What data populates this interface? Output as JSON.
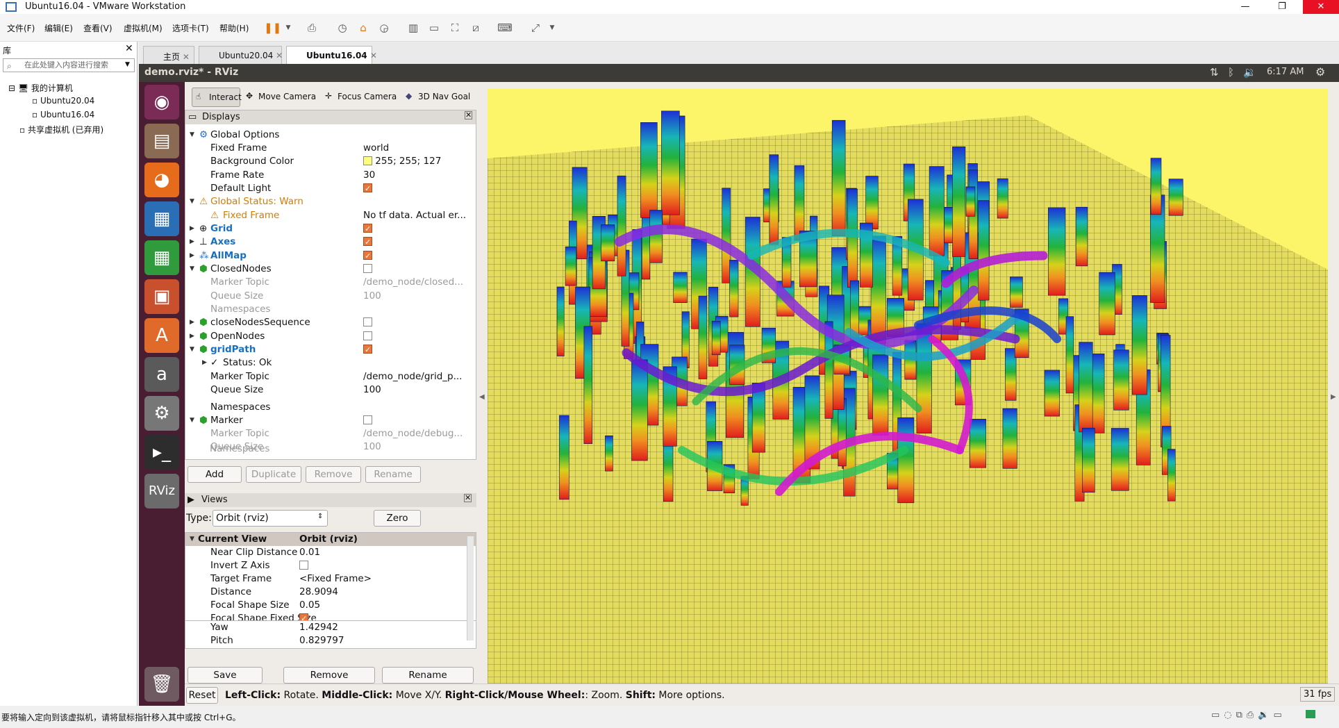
{
  "window": {
    "title": "Ubuntu16.04 - VMware Workstation"
  },
  "menu": [
    "文件(F)",
    "编辑(E)",
    "查看(V)",
    "虚拟机(M)",
    "选项卡(T)",
    "帮助(H)"
  ],
  "library": {
    "title": "库",
    "search_placeholder": "在此处键入内容进行搜索",
    "tree": [
      "我的计算机",
      "Ubuntu20.04",
      "Ubuntu16.04",
      "共享虚拟机 (已弃用)"
    ]
  },
  "tabs": [
    "主页",
    "Ubuntu20.04",
    "Ubuntu16.04"
  ],
  "ubuntu": {
    "window_title": "demo.rviz* - RViz",
    "time": "6:17 AM"
  },
  "rviz": {
    "tools": [
      "Interact",
      "Move Camera",
      "Focus Camera",
      "3D Nav Goal"
    ],
    "displays_title": "Displays",
    "display_rows": [
      {
        "key": "Global Options",
        "val": ""
      },
      {
        "key": "Fixed Frame",
        "val": "world"
      },
      {
        "key": "Background Color",
        "val": "255; 255; 127"
      },
      {
        "key": "Frame Rate",
        "val": "30"
      },
      {
        "key": "Default Light",
        "val": ""
      },
      {
        "key": "Global Status: Warn",
        "val": ""
      },
      {
        "key": "Fixed Frame",
        "val": "No tf data.  Actual er..."
      },
      {
        "key": "Grid",
        "val": ""
      },
      {
        "key": "Axes",
        "val": ""
      },
      {
        "key": "AllMap",
        "val": ""
      },
      {
        "key": "ClosedNodes",
        "val": ""
      },
      {
        "key": "Marker Topic",
        "val": "/demo_node/closed..."
      },
      {
        "key": "Queue Size",
        "val": "100"
      },
      {
        "key": "Namespaces",
        "val": ""
      },
      {
        "key": "closeNodesSequence",
        "val": ""
      },
      {
        "key": "OpenNodes",
        "val": ""
      },
      {
        "key": "gridPath",
        "val": ""
      },
      {
        "key": "Status: Ok",
        "val": ""
      },
      {
        "key": "Marker Topic",
        "val": "/demo_node/grid_p..."
      },
      {
        "key": "Queue Size",
        "val": "100"
      },
      {
        "key": "Namespaces",
        "val": ""
      },
      {
        "key": "Marker",
        "val": ""
      },
      {
        "key": "Marker Topic",
        "val": "/demo_node/debug..."
      },
      {
        "key": "Queue Size",
        "val": "100"
      },
      {
        "key": "Namespaces",
        "val": ""
      }
    ],
    "display_buttons": [
      "Add",
      "Duplicate",
      "Remove",
      "Rename"
    ],
    "views_title": "Views",
    "views_type_label": "Type:",
    "views_type_value": "Orbit (rviz)",
    "views_zero": "Zero",
    "view_rows": [
      {
        "key": "Current View",
        "val": "Orbit (rviz)"
      },
      {
        "key": "Near Clip Distance",
        "val": "0.01"
      },
      {
        "key": "Invert Z Axis",
        "val": ""
      },
      {
        "key": "Target Frame",
        "val": "<Fixed Frame>"
      },
      {
        "key": "Distance",
        "val": "28.9094"
      },
      {
        "key": "Focal Shape Size",
        "val": "0.05"
      },
      {
        "key": "Focal Shape Fixed Size",
        "val": ""
      },
      {
        "key": "Yaw",
        "val": "1.42942"
      },
      {
        "key": "Pitch",
        "val": "0.829797"
      }
    ],
    "view_buttons": [
      "Save",
      "Remove",
      "Rename"
    ],
    "reset": "Reset",
    "hint": {
      "b1": "Left-Click:",
      "t1": " Rotate. ",
      "b2": "Middle-Click:",
      "t2": " Move X/Y. ",
      "b3": "Right-Click/Mouse Wheel:",
      "t3": ": Zoom. ",
      "b4": "Shift:",
      "t4": " More options."
    },
    "fps": "31 fps"
  },
  "vm_status": "要将输入定向到该虚拟机，请将鼠标指针移入其中或按 Ctrl+G。"
}
